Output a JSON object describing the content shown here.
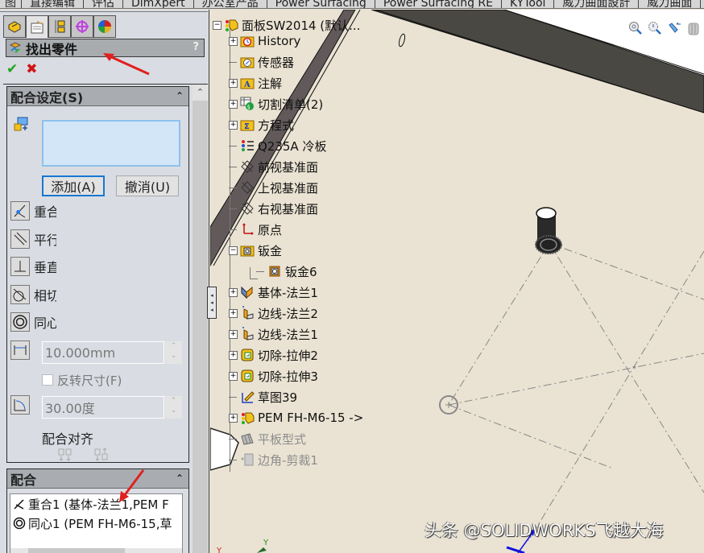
{
  "command_tabs": [
    "图",
    "直接编辑",
    "评估",
    "DimXpert",
    "办公室产品",
    "Power Surfacing",
    "Power Surfacing RE",
    "KYTool",
    "威力曲面設計",
    "威力曲面"
  ],
  "manager_tabs": [
    {
      "name": "feature-manager",
      "icon": "feature-tree-icon"
    },
    {
      "name": "property-manager",
      "icon": "property-manager-icon",
      "active": true
    },
    {
      "name": "configuration-manager",
      "icon": "configuration-icon"
    },
    {
      "name": "dimxpert-manager",
      "icon": "dimxpert-icon"
    },
    {
      "name": "display-manager",
      "icon": "display-manager-icon"
    }
  ],
  "property_manager": {
    "title": "找出零件",
    "help": "?",
    "ok_icon": "✔",
    "cancel_icon": "✖"
  },
  "mate_settings": {
    "title": "配合设定(S)",
    "add_button": "添加(A)",
    "undo_button": "撤消(U)",
    "mate_types": [
      {
        "label": "重合",
        "icon": "coincident-icon"
      },
      {
        "label": "平行",
        "icon": "parallel-icon"
      },
      {
        "label": "垂直",
        "icon": "perpendicular-icon"
      },
      {
        "label": "相切",
        "icon": "tangent-icon"
      },
      {
        "label": "同心",
        "icon": "concentric-icon"
      }
    ],
    "distance_value": "10.000mm",
    "flip_dimension_label": "反转尺寸(F)",
    "flip_dimension_checked": false,
    "angle_value": "30.00度",
    "mate_alignment_label": "配合对齐"
  },
  "mates": {
    "title": "配合",
    "items": [
      {
        "icon": "coincident-icon",
        "label": "重合1 (基体-法兰1,PEM F"
      },
      {
        "icon": "concentric-icon",
        "label": "同心1 (PEM FH-M6-15,草"
      }
    ]
  },
  "feature_tree": {
    "root": "面板SW2014 (默认...",
    "items": [
      {
        "label": "History",
        "icon": "history-folder-icon",
        "expandable": true
      },
      {
        "label": "传感器",
        "icon": "sensor-folder-icon",
        "expandable": false
      },
      {
        "label": "注解",
        "icon": "annotation-folder-icon",
        "expandable": true
      },
      {
        "label": "切割清单(2)",
        "icon": "cut-list-icon",
        "expandable": true
      },
      {
        "label": "方程式",
        "icon": "equation-folder-icon",
        "expandable": true
      },
      {
        "label": "Q235A 冷板",
        "icon": "material-icon",
        "expandable": false
      },
      {
        "label": "前视基准面",
        "icon": "plane-icon",
        "expandable": false
      },
      {
        "label": "上视基准面",
        "icon": "plane-icon",
        "expandable": false
      },
      {
        "label": "右视基准面",
        "icon": "plane-icon",
        "expandable": false
      },
      {
        "label": "原点",
        "icon": "origin-icon",
        "expandable": false
      },
      {
        "label": "钣金",
        "icon": "sheet-metal-folder-icon",
        "expandable": true,
        "expanded": true
      },
      {
        "label": "钣金6",
        "icon": "sheet-metal-icon",
        "expandable": false,
        "child": true
      },
      {
        "label": "基体-法兰1",
        "icon": "base-flange-icon",
        "expandable": true
      },
      {
        "label": "边线-法兰2",
        "icon": "edge-flange-icon",
        "expandable": true
      },
      {
        "label": "边线-法兰1",
        "icon": "edge-flange-icon",
        "expandable": true
      },
      {
        "label": "切除-拉伸2",
        "icon": "cut-extrude-icon",
        "expandable": true
      },
      {
        "label": "切除-拉伸3",
        "icon": "cut-extrude-icon",
        "expandable": true
      },
      {
        "label": "草图39",
        "icon": "sketch-icon",
        "expandable": false
      },
      {
        "label": "PEM FH-M6-15 ->",
        "icon": "part-icon",
        "expandable": true
      },
      {
        "label": "平板型式",
        "icon": "flat-pattern-icon",
        "expandable": false,
        "suppressed": true
      },
      {
        "label": "边角-剪裁1",
        "icon": "corner-trim-icon",
        "expandable": false,
        "suppressed": true
      }
    ]
  },
  "view_toolbar": [
    "zoom-to-fit-icon",
    "zoom-to-area-icon",
    "previous-view-icon",
    "section-view-icon"
  ],
  "watermark": "头条 @SOLIDWORKS飞越大海",
  "colors": {
    "accent_blue": "#1977d2",
    "selection_box": "#d2e6f8",
    "viewport_bg": "#eae3d3",
    "panel_bg": "#d9dde3",
    "annotation_arrow": "#e02020"
  }
}
